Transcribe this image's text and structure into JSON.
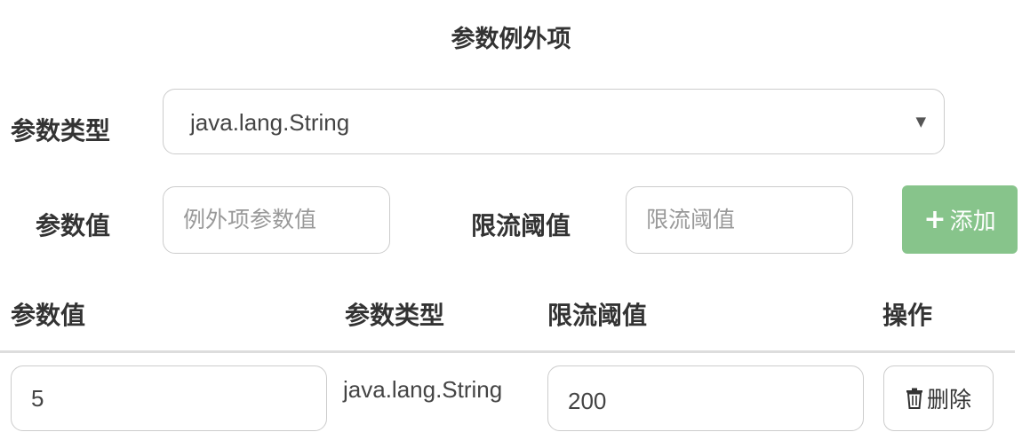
{
  "section": {
    "title": "参数例外项"
  },
  "form": {
    "param_type_label": "参数类型",
    "param_type_value": "java.lang.String",
    "param_value_label": "参数值",
    "param_value_placeholder": "例外项参数值",
    "threshold_label": "限流阈值",
    "threshold_placeholder": "限流阈值",
    "add_button_label": "添加",
    "add_button_icon": "plus-icon"
  },
  "table": {
    "headers": [
      "参数值",
      "参数类型",
      "限流阈值",
      "操作"
    ],
    "rows": [
      {
        "param_value": "5",
        "param_type": "java.lang.String",
        "threshold": "200",
        "delete_label": "删除",
        "delete_icon": "trash-icon"
      }
    ]
  },
  "colors": {
    "add_button_bg": "#87c48b",
    "border": "#cccccc"
  }
}
